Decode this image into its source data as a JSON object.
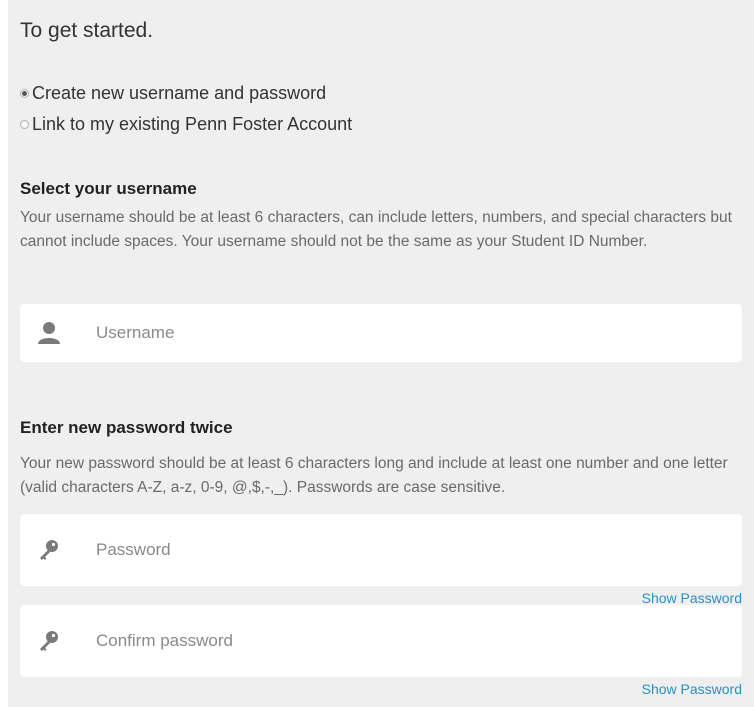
{
  "title": "To get started.",
  "options": [
    {
      "label": "Create new username and password",
      "checked": true
    },
    {
      "label": "Link to my existing Penn Foster Account",
      "checked": false
    }
  ],
  "username_section": {
    "heading": "Select your username",
    "help": "Your username should be at least 6 characters, can include letters, numbers, and special characters but cannot include spaces. Your username should not be the same as your Student ID Number.",
    "field": {
      "placeholder": "Username",
      "value": "",
      "icon": "user-icon"
    }
  },
  "password_section": {
    "heading": "Enter new password twice",
    "help": "Your new password should be at least 6 characters long and include at least one number and one letter (valid characters A-Z, a-z, 0-9, @,$,-,_). Passwords are case sensitive.",
    "password_field": {
      "placeholder": "Password",
      "value": "",
      "icon": "key-icon"
    },
    "confirm_field": {
      "placeholder": "Confirm password",
      "value": "",
      "icon": "key-icon"
    },
    "show_password_label": "Show Password"
  },
  "colors": {
    "panel_background": "#efefef",
    "field_background": "#ffffff",
    "link": "#2a8fc7",
    "help_text": "#6a6a6a",
    "icon": "#7a7a7a"
  }
}
